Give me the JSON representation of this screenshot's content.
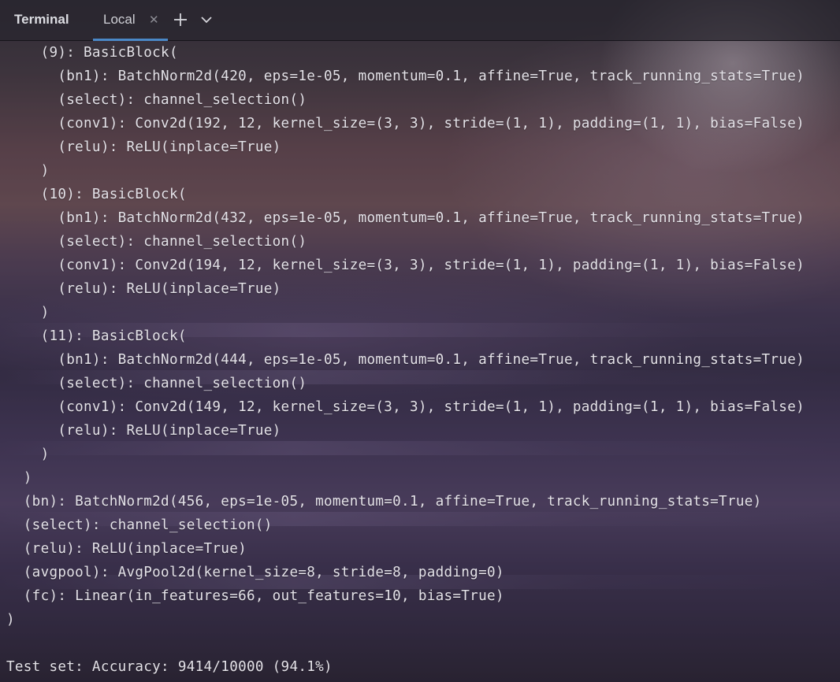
{
  "header": {
    "title": "Terminal",
    "tab_label": "Local",
    "tab_close_icon": "close-icon",
    "new_tab_icon": "plus-icon",
    "options_icon": "chevron-down-icon"
  },
  "colors": {
    "tab_underline": "#4a88c7",
    "text": "#e4e2e8"
  },
  "output": {
    "lines": [
      "    (9): BasicBlock(",
      "      (bn1): BatchNorm2d(420, eps=1e-05, momentum=0.1, affine=True, track_running_stats=True)",
      "      (select): channel_selection()",
      "      (conv1): Conv2d(192, 12, kernel_size=(3, 3), stride=(1, 1), padding=(1, 1), bias=False)",
      "      (relu): ReLU(inplace=True)",
      "    )",
      "    (10): BasicBlock(",
      "      (bn1): BatchNorm2d(432, eps=1e-05, momentum=0.1, affine=True, track_running_stats=True)",
      "      (select): channel_selection()",
      "      (conv1): Conv2d(194, 12, kernel_size=(3, 3), stride=(1, 1), padding=(1, 1), bias=False)",
      "      (relu): ReLU(inplace=True)",
      "    )",
      "    (11): BasicBlock(",
      "      (bn1): BatchNorm2d(444, eps=1e-05, momentum=0.1, affine=True, track_running_stats=True)",
      "      (select): channel_selection()",
      "      (conv1): Conv2d(149, 12, kernel_size=(3, 3), stride=(1, 1), padding=(1, 1), bias=False)",
      "      (relu): ReLU(inplace=True)",
      "    )",
      "  )",
      "  (bn): BatchNorm2d(456, eps=1e-05, momentum=0.1, affine=True, track_running_stats=True)",
      "  (select): channel_selection()",
      "  (relu): ReLU(inplace=True)",
      "  (avgpool): AvgPool2d(kernel_size=8, stride=8, padding=0)",
      "  (fc): Linear(in_features=66, out_features=10, bias=True)",
      ")",
      "",
      "Test set: Accuracy: 9414/10000 (94.1%)"
    ]
  }
}
